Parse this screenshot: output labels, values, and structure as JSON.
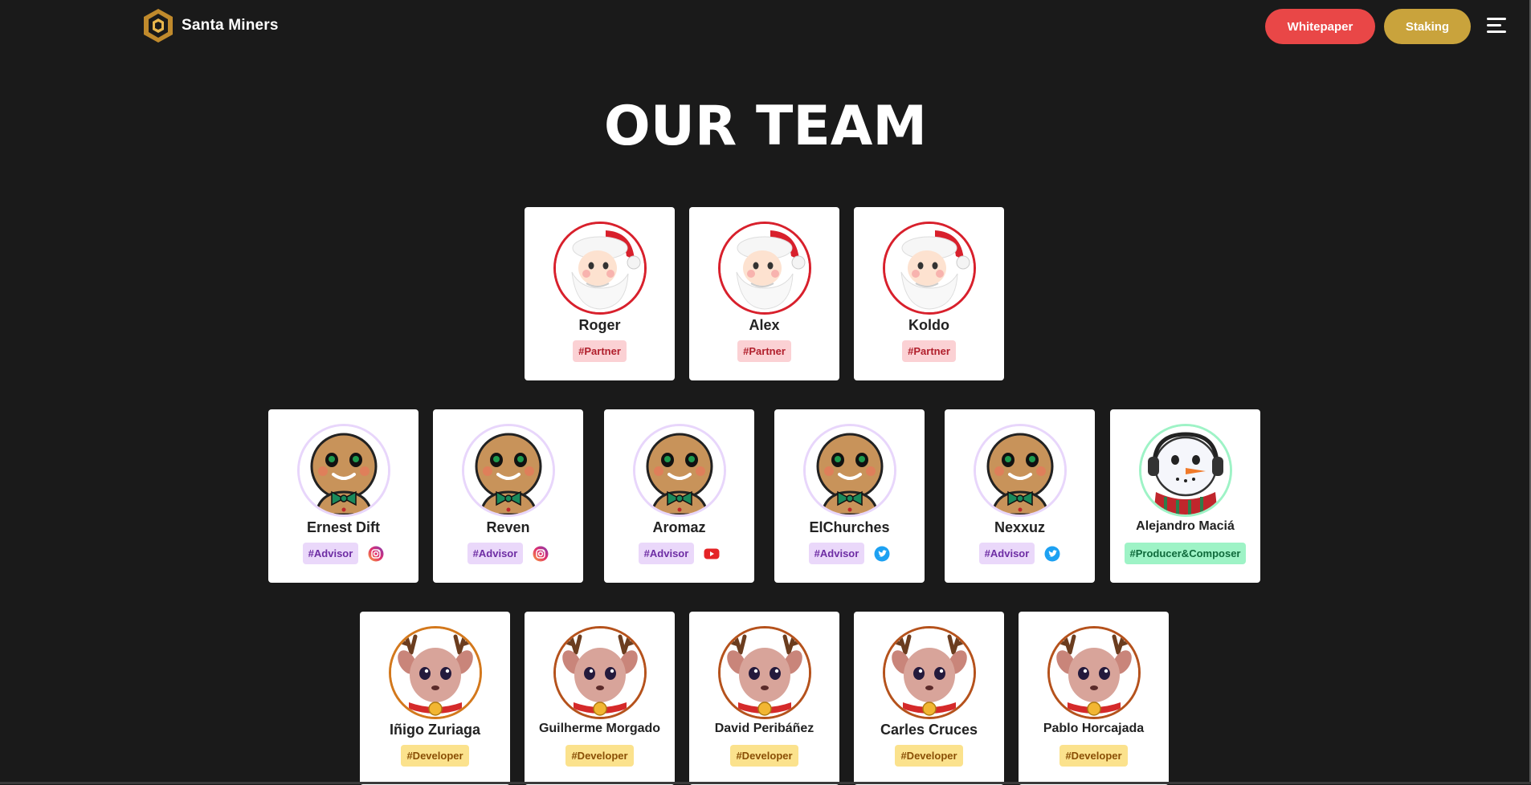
{
  "header": {
    "brand": "Santa Miners",
    "whitepaper_label": "Whitepaper",
    "staking_label": "Staking"
  },
  "page_title": "OUR TEAM",
  "colors": {
    "background": "#1a1a1a",
    "whitepaper": "#e94747",
    "staking": "#c9a33c",
    "partner_ring": "#d8202c",
    "advisor_ring": "#e8d6fb",
    "producer_ring": "#9ef3c6",
    "developer_ring": "#c0621a"
  },
  "team": {
    "partners": [
      {
        "name": "Roger",
        "tag": "#Partner"
      },
      {
        "name": "Alex",
        "tag": "#Partner"
      },
      {
        "name": "Koldo",
        "tag": "#Partner"
      }
    ],
    "advisors": [
      {
        "name": "Ernest Dift",
        "tag": "#Advisor",
        "social": "instagram-icon"
      },
      {
        "name": "Reven",
        "tag": "#Advisor",
        "social": "instagram-icon"
      },
      {
        "name": "Aromaz",
        "tag": "#Advisor",
        "social": "youtube-icon"
      },
      {
        "name": "ElChurches",
        "tag": "#Advisor",
        "social": "twitter-icon"
      },
      {
        "name": "Nexxuz",
        "tag": "#Advisor",
        "social": "twitter-icon"
      },
      {
        "name": "Alejandro Maciá",
        "tag": "#Producer&Composer"
      }
    ],
    "developers": [
      {
        "name": "Iñigo Zuriaga",
        "tag": "#Developer"
      },
      {
        "name": "Guilherme Morgado",
        "tag": "#Developer"
      },
      {
        "name": "David Peribáñez",
        "tag": "#Developer"
      },
      {
        "name": "Carles Cruces",
        "tag": "#Developer"
      },
      {
        "name": "Pablo Horcajada",
        "tag": "#Developer"
      }
    ]
  }
}
